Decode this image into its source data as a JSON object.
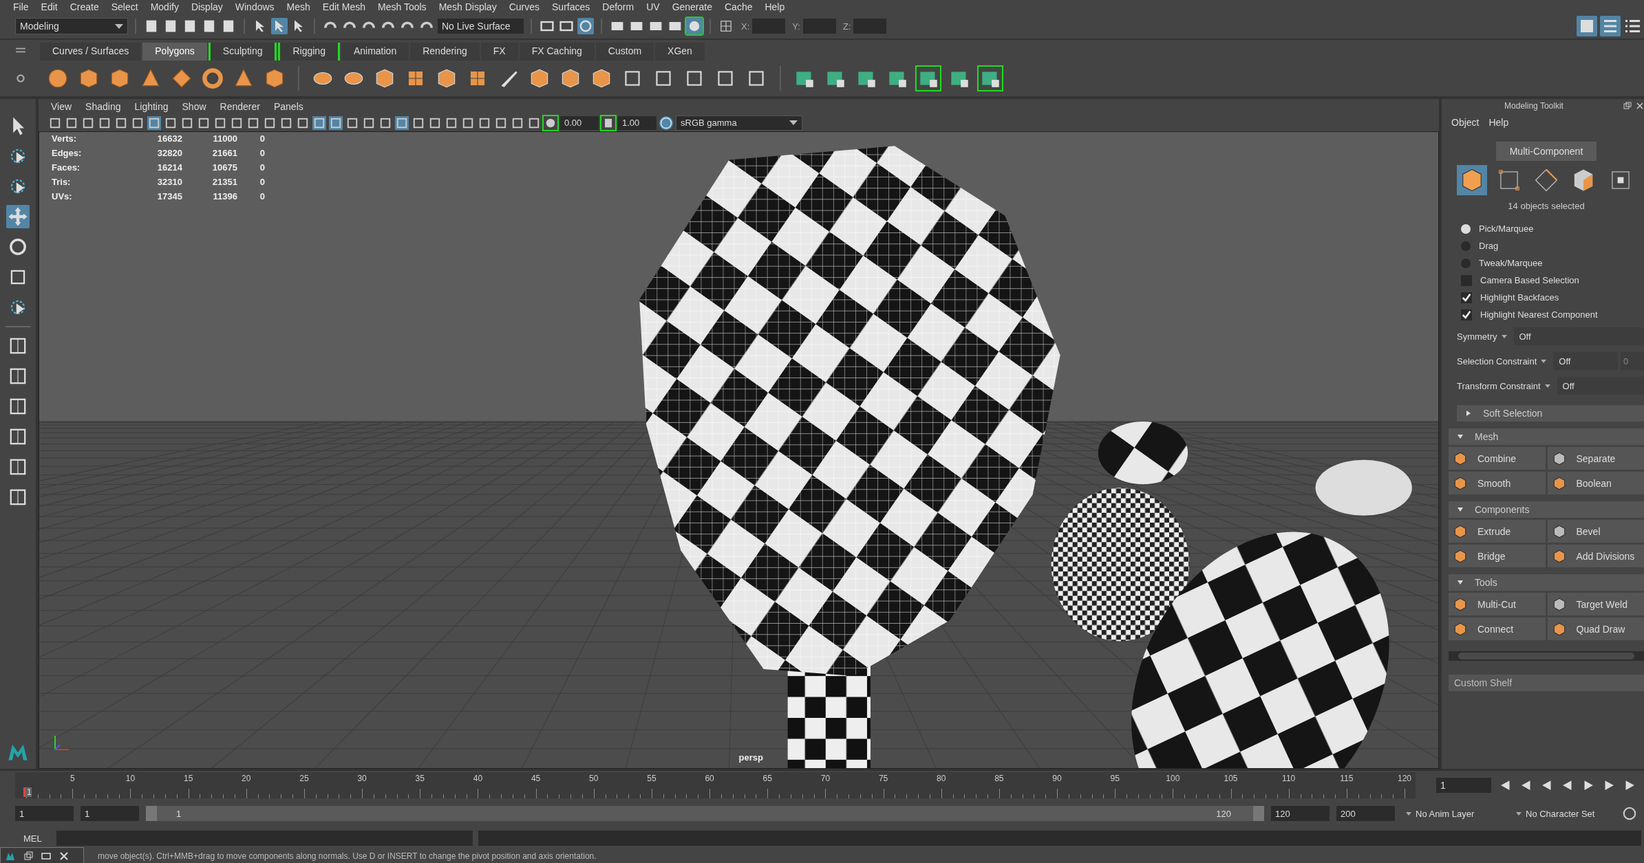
{
  "menu_bar": [
    "File",
    "Edit",
    "Create",
    "Select",
    "Modify",
    "Display",
    "Windows",
    "Mesh",
    "Edit Mesh",
    "Mesh Tools",
    "Mesh Display",
    "Curves",
    "Surfaces",
    "Deform",
    "UV",
    "Generate",
    "Cache",
    "Help"
  ],
  "status_line": {
    "mode": "Modeling",
    "live_surface": "No Live Surface",
    "coord_labels": [
      "X:",
      "Y:",
      "Z:"
    ]
  },
  "shelf_tabs": [
    {
      "label": "Curves / Surfaces",
      "selected": false,
      "bracketed": false
    },
    {
      "label": "Polygons",
      "selected": true,
      "bracketed": false
    },
    {
      "label": "Sculpting",
      "selected": false,
      "bracketed": true
    },
    {
      "label": "Rigging",
      "selected": false,
      "bracketed": true
    },
    {
      "label": "Animation",
      "selected": false,
      "bracketed": false
    },
    {
      "label": "Rendering",
      "selected": false,
      "bracketed": false
    },
    {
      "label": "FX",
      "selected": false,
      "bracketed": false
    },
    {
      "label": "FX Caching",
      "selected": false,
      "bracketed": false
    },
    {
      "label": "Custom",
      "selected": false,
      "bracketed": false
    },
    {
      "label": "XGen",
      "selected": false,
      "bracketed": false
    }
  ],
  "viewport": {
    "menu": [
      "View",
      "Shading",
      "Lighting",
      "Show",
      "Renderer",
      "Panels"
    ],
    "exposure": "0.00",
    "gamma": "1.00",
    "color_space": "sRGB gamma",
    "camera": "persp",
    "hud_stats": [
      {
        "label": "Verts:",
        "values": [
          "16632",
          "11000",
          "0"
        ]
      },
      {
        "label": "Edges:",
        "values": [
          "32820",
          "21661",
          "0"
        ]
      },
      {
        "label": "Faces:",
        "values": [
          "16214",
          "10675",
          "0"
        ]
      },
      {
        "label": "Tris:",
        "values": [
          "32310",
          "21351",
          "0"
        ]
      },
      {
        "label": "UVs:",
        "values": [
          "17345",
          "11396",
          "0"
        ]
      }
    ]
  },
  "toolkit": {
    "title": "Modeling Toolkit",
    "menu": [
      "Object",
      "Help"
    ],
    "mode": "Multi-Component",
    "component_modes": [
      {
        "selected": true
      },
      {
        "selected": false
      },
      {
        "selected": false
      },
      {
        "selected": false
      },
      {
        "selected": false
      }
    ],
    "selection_info": "14 objects selected",
    "radios": [
      {
        "label": "Pick/Marquee",
        "selected": true
      },
      {
        "label": "Drag",
        "selected": false
      },
      {
        "label": "Tweak/Marquee",
        "selected": false
      }
    ],
    "checkboxes": [
      {
        "label": "Camera Based Selection",
        "checked": false
      },
      {
        "label": "Highlight Backfaces",
        "checked": true
      },
      {
        "label": "Highlight Nearest Component",
        "checked": true
      }
    ],
    "dropdowns": [
      {
        "label": "Symmetry",
        "value": "Off"
      },
      {
        "label": "Selection Constraint",
        "value": "Off",
        "extra": "0"
      },
      {
        "label": "Transform Constraint",
        "value": "Off"
      }
    ],
    "sections": [
      {
        "title": "Soft Selection",
        "expanded": false
      },
      {
        "title": "Mesh",
        "expanded": true,
        "tools": [
          "Combine",
          "Separate",
          "Smooth",
          "Boolean"
        ]
      },
      {
        "title": "Components",
        "expanded": true,
        "tools": [
          "Extrude",
          "Bevel",
          "Bridge",
          "Add Divisions"
        ]
      },
      {
        "title": "Tools",
        "expanded": true,
        "tools": [
          "Multi-Cut",
          "Target Weld",
          "Connect",
          "Quad Draw"
        ]
      }
    ],
    "custom_shelf": "Custom Shelf"
  },
  "timeline": {
    "ticks": [
      "5",
      "10",
      "15",
      "20",
      "25",
      "30",
      "35",
      "40",
      "45",
      "50",
      "55",
      "60",
      "65",
      "70",
      "75",
      "80",
      "85",
      "90",
      "95",
      "100",
      "105",
      "110",
      "115",
      "120"
    ],
    "current_frame_mark": "1",
    "current_frame": "1",
    "level": 0
  },
  "range": {
    "start": "1",
    "anim_start": "1",
    "slider_start": "1",
    "slider_end": "120",
    "anim_end": "120",
    "end": "200",
    "level": 1,
    "anim_layer": "No Anim Layer",
    "character_set": "No Character Set"
  },
  "command_line": {
    "label": "MEL"
  },
  "help_line": "move object(s). Ctrl+MMB+drag to move components along normals. Use D or INSERT to change the pivot position and axis orientation."
}
